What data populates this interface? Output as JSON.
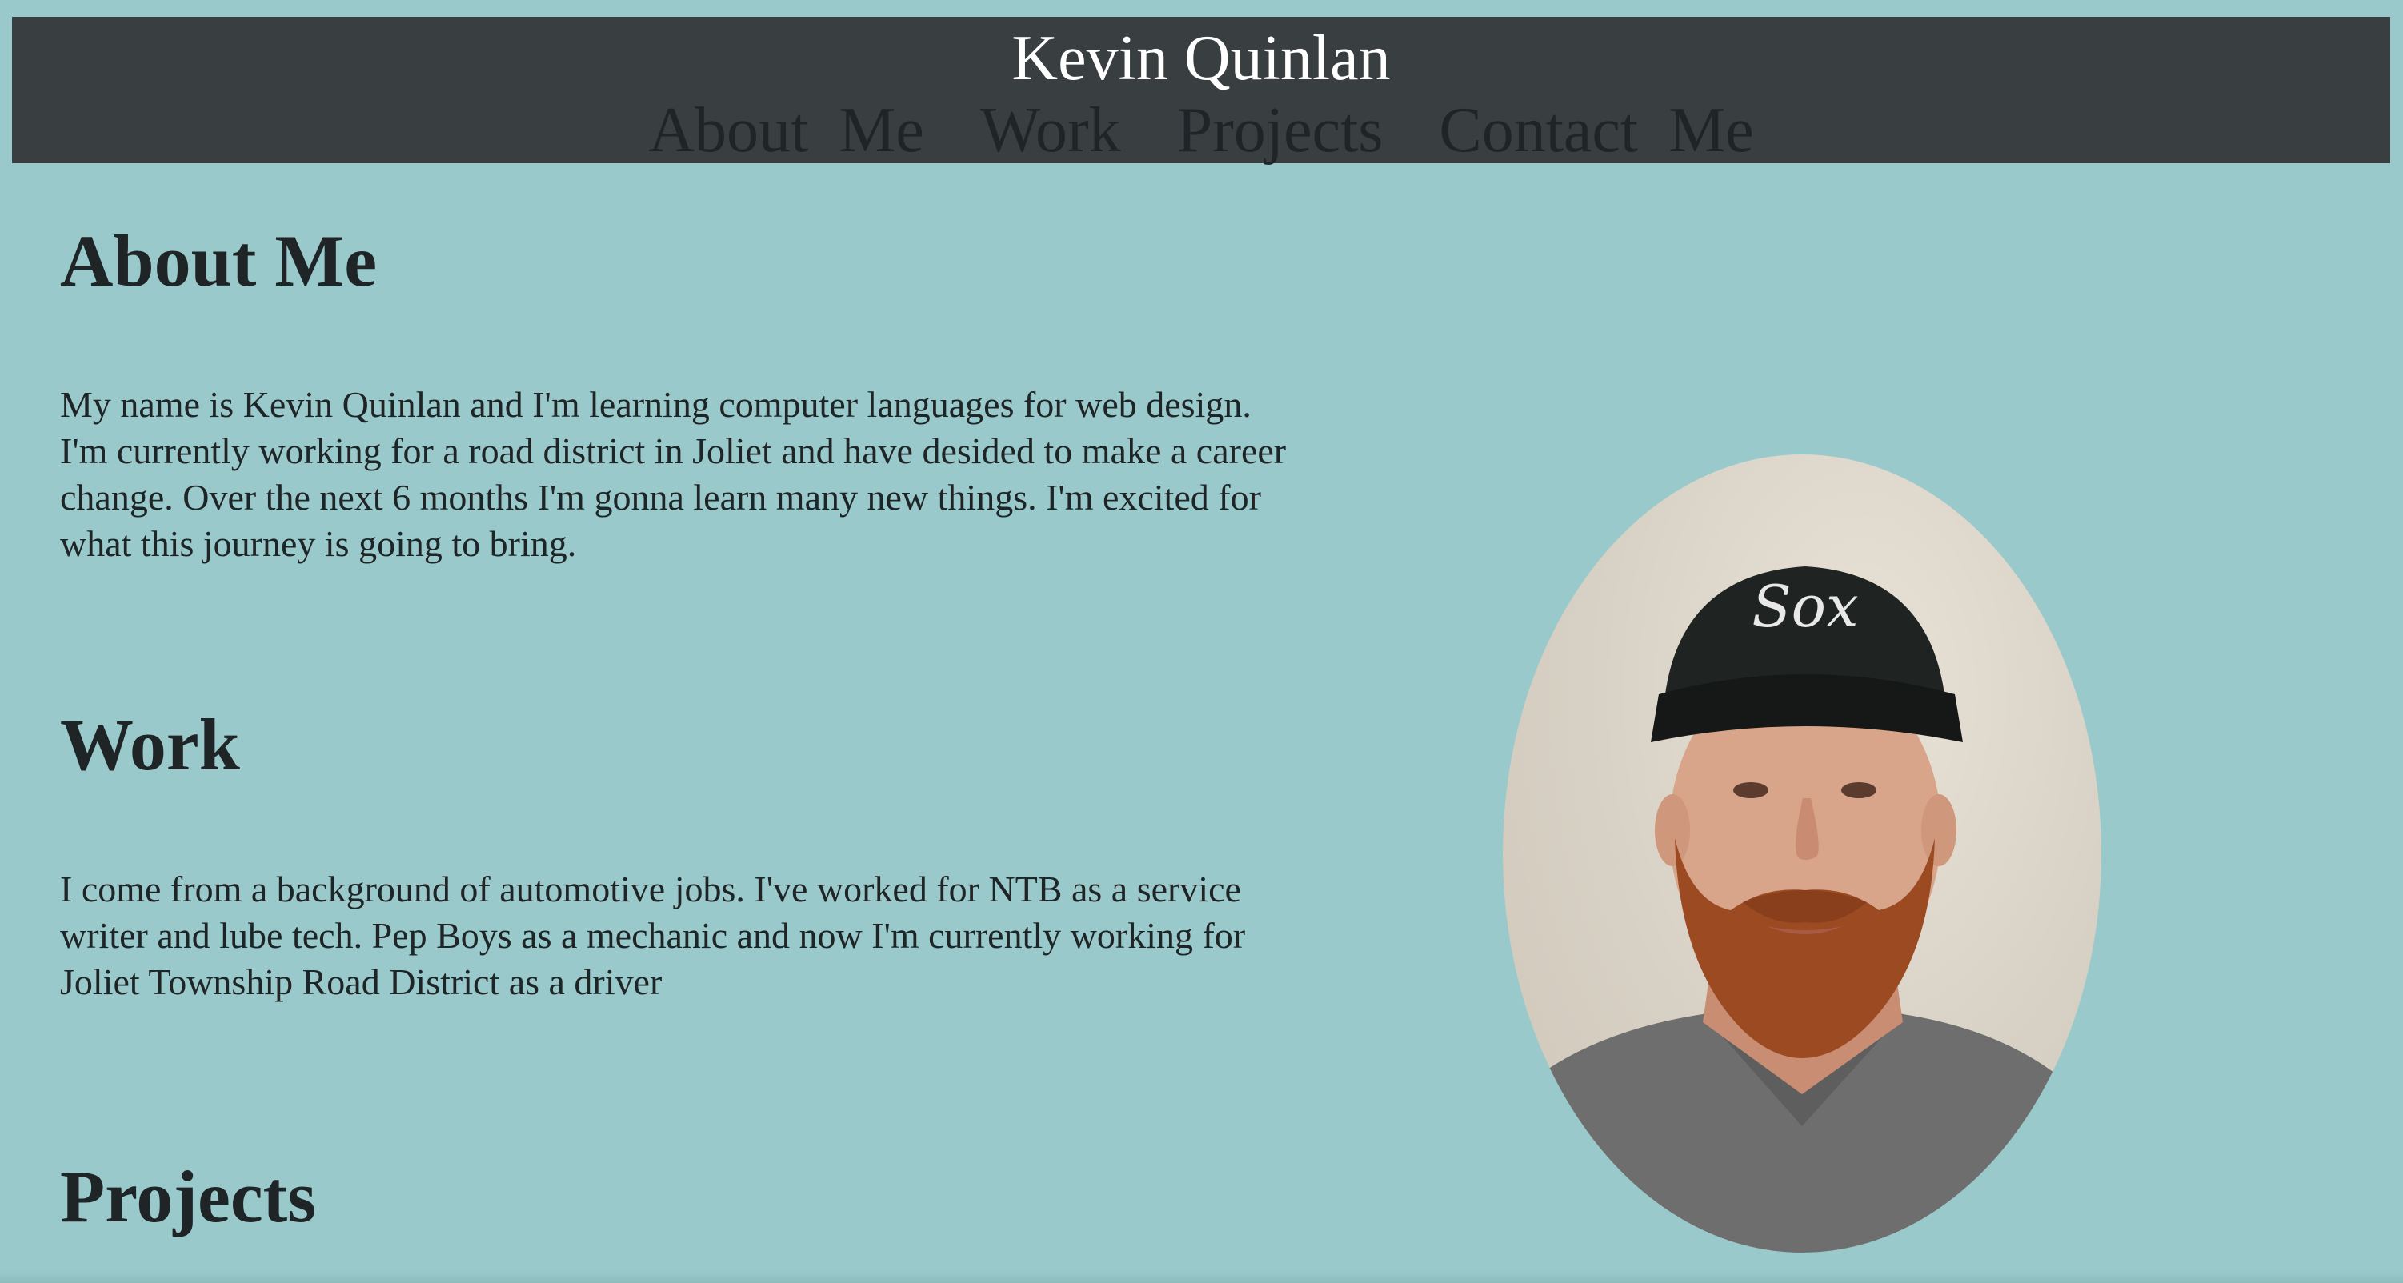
{
  "header": {
    "title": "Kevin Quinlan",
    "nav": [
      {
        "label": "About Me"
      },
      {
        "label": "Work"
      },
      {
        "label": "Projects"
      },
      {
        "label": "Contact Me"
      }
    ]
  },
  "sections": {
    "about": {
      "heading": "About Me",
      "body": "My name is Kevin Quinlan and I'm learning computer languages for web design. I'm currently working for a road district in Joliet and have desided to make a career change. Over the next 6 months I'm gonna learn many new things. I'm excited for what this journey is going to bring."
    },
    "work": {
      "heading": "Work",
      "body": "I come from a background of automotive jobs. I've worked for NTB as a service writer and lube tech. Pep Boys as a mechanic and now I'm currently working for Joliet Township Road District as a driver"
    },
    "projects": {
      "heading": "Projects"
    }
  },
  "colors": {
    "page_background": "#99c9ca",
    "header_background": "#393e41",
    "title_text": "#ffffff",
    "body_text": "#1f2426"
  }
}
